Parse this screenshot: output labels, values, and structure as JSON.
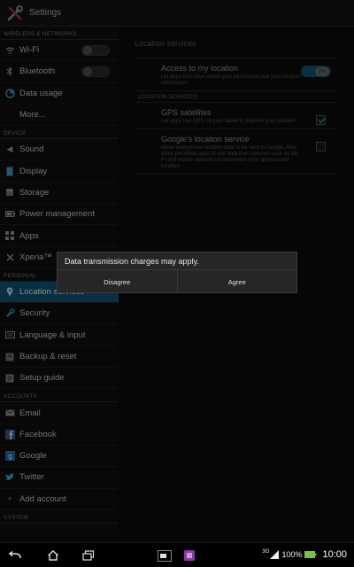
{
  "titlebar": {
    "title": "Settings"
  },
  "sidebar": {
    "sections": {
      "wireless": "WIRELESS & NETWORKS",
      "device": "DEVICE",
      "personal": "PERSONAL",
      "accounts": "ACCOUNTS",
      "system": "SYSTEM"
    },
    "items": {
      "wifi": "Wi-Fi",
      "bluetooth": "Bluetooth",
      "data_usage": "Data usage",
      "more": "More...",
      "sound": "Sound",
      "display": "Display",
      "storage": "Storage",
      "power": "Power management",
      "apps": "Apps",
      "xperia": "Xperia™",
      "location": "Location services",
      "security": "Security",
      "language": "Language & input",
      "backup": "Backup & reset",
      "setup": "Setup guide",
      "email": "Email",
      "facebook": "Facebook",
      "google": "Google",
      "twitter": "Twitter",
      "add_account": "Add account"
    }
  },
  "content": {
    "title": "Location services",
    "access": {
      "label": "Access to my location",
      "desc": "Let apps that have asked your permission use your location information",
      "toggle": "ON"
    },
    "sources_header": "LOCATION SOURCES",
    "gps": {
      "label": "GPS satellites",
      "desc": "Let apps use GPS on your tablet to pinpoint your location"
    },
    "google_loc": {
      "label": "Google's location service",
      "desc": "Allow anonymous location data to be sent to Google. Also allow permitted apps to use data from sources such as Wi-Fi and mobile networks to determine your approximate location."
    }
  },
  "dialog": {
    "message": "Data transmission charges may apply.",
    "disagree": "Disagree",
    "agree": "Agree"
  },
  "status": {
    "network": "3G",
    "battery": "100%",
    "time": "10:00"
  },
  "colors": {
    "accent": "#0f5876",
    "background": "#000000"
  }
}
